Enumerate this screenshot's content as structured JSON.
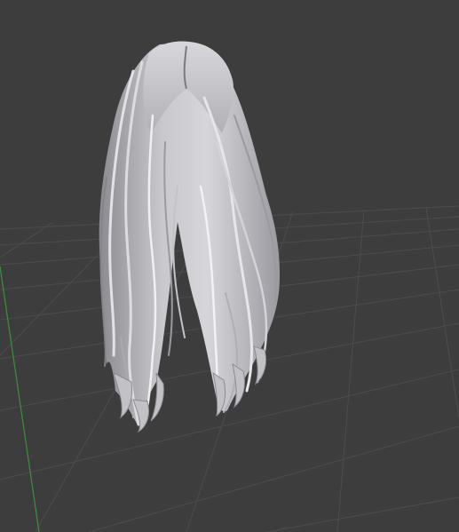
{
  "viewport": {
    "background": "#3d3d3d",
    "grid_color": "#4c4c4c",
    "y_axis_color": "#3e8a3e"
  },
  "scene": {
    "object": "hair-mesh",
    "shading": "solid",
    "base_color": "#b8b8bc",
    "shadow_color": "#6e6e74",
    "highlight_color": "#e4e4e8"
  }
}
